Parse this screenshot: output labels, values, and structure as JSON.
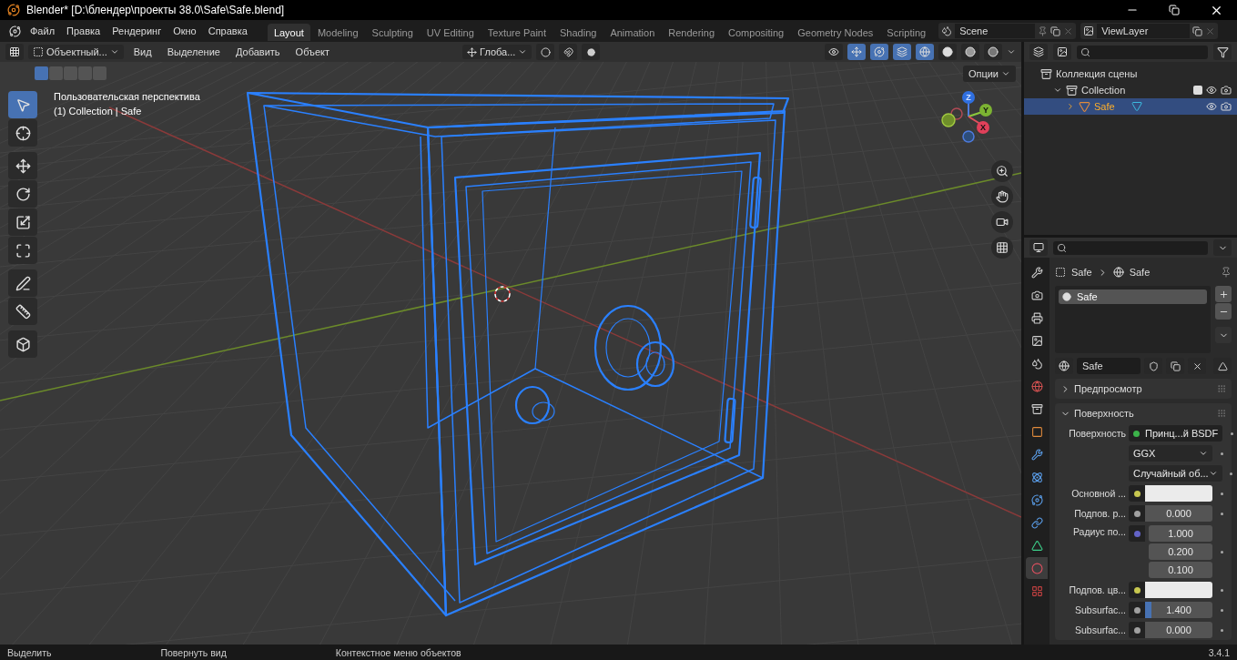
{
  "window": {
    "title": "Blender* [D:\\блендер\\проекты 38.0\\Safe\\Safe.blend]"
  },
  "menu": [
    "Файл",
    "Правка",
    "Рендеринг",
    "Окно",
    "Справка"
  ],
  "workspaces": [
    {
      "label": "Layout",
      "selected": true
    },
    {
      "label": "Modeling",
      "selected": false
    },
    {
      "label": "Sculpting",
      "selected": false
    },
    {
      "label": "UV Editing",
      "selected": false
    },
    {
      "label": "Texture Paint",
      "selected": false
    },
    {
      "label": "Shading",
      "selected": false
    },
    {
      "label": "Animation",
      "selected": false
    },
    {
      "label": "Rendering",
      "selected": false
    },
    {
      "label": "Compositing",
      "selected": false
    },
    {
      "label": "Geometry Nodes",
      "selected": false
    },
    {
      "label": "Scripting",
      "selected": false
    }
  ],
  "scene": "Scene",
  "view_layer": "ViewLayer",
  "viewport_header": {
    "mode": "Объектный...",
    "menus": [
      "Вид",
      "Выделение",
      "Добавить",
      "Объект"
    ],
    "orientation": "Глоба...",
    "xray": true,
    "shading": [
      {
        "kind": "wireframe",
        "selected": true
      },
      {
        "kind": "solid",
        "selected": false
      },
      {
        "kind": "material",
        "selected": false
      },
      {
        "kind": "rendered",
        "selected": false
      }
    ]
  },
  "select_modes": [
    {
      "selected": true
    },
    {
      "selected": false
    },
    {
      "selected": false
    },
    {
      "selected": false
    },
    {
      "selected": false
    }
  ],
  "viewport": {
    "view_name": "Пользовательская перспектива",
    "context": "(1) Collection | Safe",
    "options": "Опции",
    "axes": [
      "Z",
      "Y",
      "X"
    ],
    "tools": [
      {
        "kind": "select",
        "selected": true
      },
      {
        "kind": "cursor",
        "selected": false
      },
      {
        "kind": "move",
        "selected": false
      },
      {
        "kind": "rotate",
        "selected": false
      },
      {
        "kind": "scale",
        "selected": false
      },
      {
        "kind": "transform",
        "selected": false
      },
      {
        "kind": "annotate",
        "selected": false
      },
      {
        "kind": "measure",
        "selected": false
      },
      {
        "kind": "add_cube",
        "selected": false
      }
    ]
  },
  "outliner": {
    "items": [
      {
        "label": "Коллекция сцены",
        "selected": false,
        "children": [
          {
            "label": "Collection",
            "selected": false,
            "expanded": true,
            "checked": true,
            "children": [
              {
                "label": "Safe",
                "selected": true,
                "expanded": false
              }
            ]
          }
        ]
      }
    ]
  },
  "properties": {
    "tabs": [
      {
        "kind": "tool",
        "selected": false
      },
      {
        "kind": "render",
        "selected": false
      },
      {
        "kind": "output",
        "selected": false
      },
      {
        "kind": "view_layer",
        "selected": false
      },
      {
        "kind": "scene",
        "selected": false
      },
      {
        "kind": "world",
        "selected": false
      },
      {
        "kind": "collection",
        "selected": false
      },
      {
        "kind": "object",
        "selected": false
      },
      {
        "kind": "modifiers",
        "selected": false
      },
      {
        "kind": "particles",
        "selected": false
      },
      {
        "kind": "physics",
        "selected": false
      },
      {
        "kind": "constraints",
        "selected": false
      },
      {
        "kind": "data",
        "selected": false
      },
      {
        "kind": "material",
        "selected": true
      },
      {
        "kind": "texture",
        "selected": false
      }
    ],
    "breadcrumb": [
      "Safe",
      "Safe"
    ],
    "slots": [
      {
        "label": "Safe",
        "selected": true
      }
    ],
    "material": "Safe",
    "panels": [
      {
        "label": "Предпросмотр",
        "expanded": false
      },
      {
        "label": "Поверхность",
        "expanded": true
      }
    ],
    "fields": [
      {
        "kind": "link",
        "label": "Поверхность",
        "color": "#3cb34a",
        "value": "Принц...й BSDF"
      },
      {
        "kind": "dropdown",
        "value": "GGX"
      },
      {
        "kind": "dropdown",
        "value": "Случайный об..."
      },
      {
        "kind": "color",
        "label": "Основной ...",
        "color": "#c8c850"
      },
      {
        "kind": "number",
        "label": "Подпов. р...",
        "color": "#a0a0a0",
        "value": "0.000"
      },
      {
        "kind": "vector",
        "label": "Радиус по...",
        "color": "#6363c7",
        "values": [
          "1.000",
          "0.200",
          "0.100"
        ]
      },
      {
        "kind": "color",
        "label": "Подпов. цв...",
        "color": "#c8c850"
      },
      {
        "kind": "slider",
        "label": "Subsurfac...",
        "color": "#a0a0a0",
        "value": "1.400",
        "level": 0.1
      },
      {
        "kind": "number",
        "label": "Subsurfac...",
        "color": "#a0a0a0",
        "value": "0.000"
      }
    ]
  },
  "status_bar": {
    "hints": [
      "Выделить",
      "Повернуть вид",
      "Контекстное меню объектов"
    ],
    "version": "3.4.1"
  }
}
